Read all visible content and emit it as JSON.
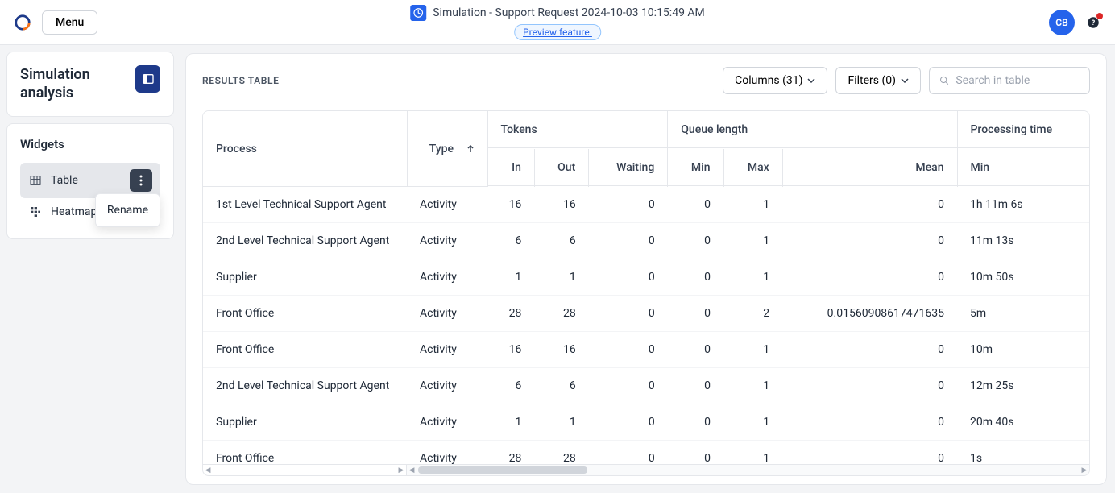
{
  "header": {
    "menu_label": "Menu",
    "title": "Simulation - Support Request 2024-10-03 10:15:49 AM",
    "preview_label": "Preview feature.",
    "avatar_initials": "CB"
  },
  "sidebar": {
    "panel_title": "Simulation analysis",
    "widgets_label": "Widgets",
    "items": [
      {
        "label": "Table",
        "active": true
      },
      {
        "label": "Heatmap",
        "active": false
      }
    ],
    "menu_action": "Rename"
  },
  "results": {
    "title": "RESULTS TABLE",
    "columns_btn": "Columns (31)",
    "filters_btn": "Filters (0)",
    "search_placeholder": "Search in table",
    "headers": {
      "process": "Process",
      "type": "Type",
      "tokens": "Tokens",
      "tokens_in": "In",
      "tokens_out": "Out",
      "tokens_waiting": "Waiting",
      "queue": "Queue length",
      "queue_min": "Min",
      "queue_max": "Max",
      "queue_mean": "Mean",
      "proc": "Processing time",
      "proc_min": "Min"
    },
    "rows": [
      {
        "process": "1st Level Technical Support Agent",
        "type": "Activity",
        "in": "16",
        "out": "16",
        "waiting": "0",
        "qmin": "0",
        "qmax": "1",
        "qmean": "0",
        "pmin": "1h 11m 6s"
      },
      {
        "process": "2nd Level Technical Support Agent",
        "type": "Activity",
        "in": "6",
        "out": "6",
        "waiting": "0",
        "qmin": "0",
        "qmax": "1",
        "qmean": "0",
        "pmin": "11m 13s"
      },
      {
        "process": "Supplier",
        "type": "Activity",
        "in": "1",
        "out": "1",
        "waiting": "0",
        "qmin": "0",
        "qmax": "1",
        "qmean": "0",
        "pmin": "10m 50s"
      },
      {
        "process": "Front Office",
        "type": "Activity",
        "in": "28",
        "out": "28",
        "waiting": "0",
        "qmin": "0",
        "qmax": "2",
        "qmean": "0.01560908617471635",
        "pmin": "5m"
      },
      {
        "process": "Front Office",
        "type": "Activity",
        "in": "16",
        "out": "16",
        "waiting": "0",
        "qmin": "0",
        "qmax": "1",
        "qmean": "0",
        "pmin": "10m"
      },
      {
        "process": "2nd Level Technical Support Agent",
        "type": "Activity",
        "in": "6",
        "out": "6",
        "waiting": "0",
        "qmin": "0",
        "qmax": "1",
        "qmean": "0",
        "pmin": "12m 25s"
      },
      {
        "process": "Supplier",
        "type": "Activity",
        "in": "1",
        "out": "1",
        "waiting": "0",
        "qmin": "0",
        "qmax": "1",
        "qmean": "0",
        "pmin": "20m 40s"
      },
      {
        "process": "Front Office",
        "type": "Activity",
        "in": "28",
        "out": "28",
        "waiting": "0",
        "qmin": "0",
        "qmax": "1",
        "qmean": "0",
        "pmin": "1s"
      }
    ]
  }
}
